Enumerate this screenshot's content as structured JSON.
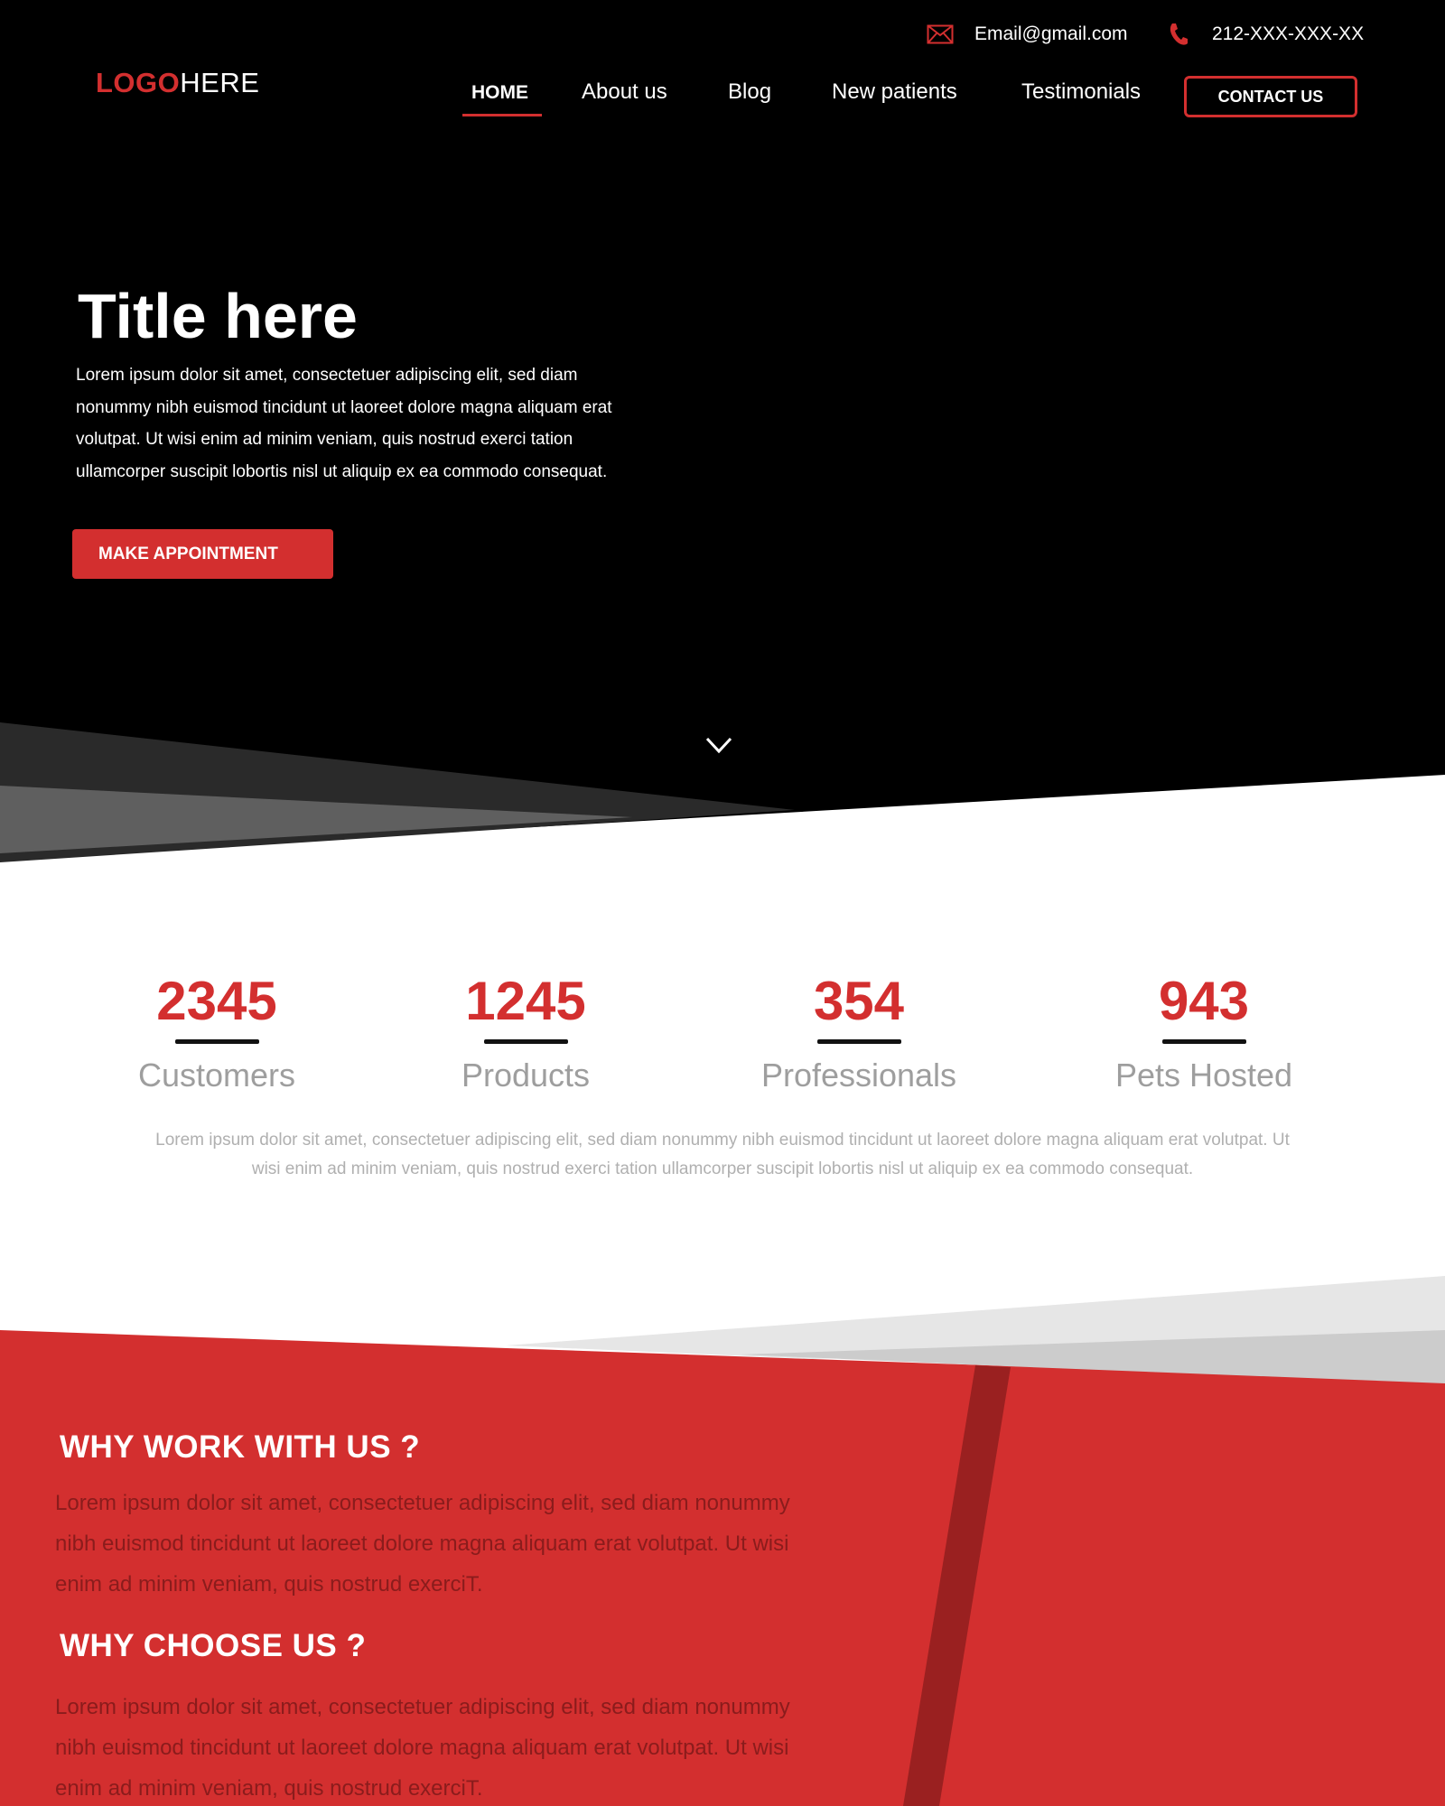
{
  "colors": {
    "accent": "#d32f2f",
    "dark_accent": "#9a2020",
    "hero_bg": "#000000",
    "muted_text": "#9e9e9e"
  },
  "contact_bar": {
    "email": "Email@gmail.com",
    "email_icon": "envelope-icon",
    "phone": "212-XXX-XXX-XX",
    "phone_icon": "phone-icon"
  },
  "logo": {
    "part1": "LOGO",
    "part2": "HERE"
  },
  "nav": {
    "items": [
      {
        "label": "HOME",
        "active": true
      },
      {
        "label": "About us"
      },
      {
        "label": "Blog"
      },
      {
        "label": "New patients"
      },
      {
        "label": "Testimonials"
      }
    ],
    "contact_button": "CONTACT US"
  },
  "hero": {
    "title": "Title here",
    "text": "Lorem ipsum dolor sit amet, consectetuer adipiscing elit, sed diam nonummy nibh euismod tincidunt ut laoreet dolore magna aliquam erat volutpat. Ut wisi enim ad minim veniam, quis nostrud exerci tation ullamcorper suscipit lobortis nisl ut aliquip ex ea commodo consequat.",
    "button": "MAKE APPOINTMENT",
    "scroll_icon": "chevron-down-icon"
  },
  "stats": {
    "items": [
      {
        "value": "2345",
        "label": "Customers"
      },
      {
        "value": "1245",
        "label": "Products"
      },
      {
        "value": "354",
        "label": "Professionals"
      },
      {
        "value": "943",
        "label": "Pets Hosted"
      }
    ],
    "text": "Lorem ipsum dolor sit amet, consectetuer adipiscing elit, sed diam nonummy nibh euismod tincidunt ut laoreet dolore magna aliquam erat volutpat. Ut wisi enim ad minim veniam, quis nostrud exerci tation ullamcorper suscipit lobortis nisl ut aliquip ex ea commodo consequat."
  },
  "red_section": {
    "heading1": "WHY WORK WITH US ?",
    "text1": "Lorem ipsum dolor sit amet, consectetuer adipiscing elit, sed diam nonummy nibh euismod tincidunt ut laoreet dolore magna aliquam erat volutpat. Ut wisi enim ad minim veniam, quis nostrud exerciT.",
    "heading2": "WHY CHOOSE US ?",
    "text2": "Lorem ipsum dolor sit amet, consectetuer adipiscing elit, sed diam nonummy nibh euismod tincidunt ut laoreet dolore magna aliquam erat volutpat. Ut wisi enim ad minim veniam, quis nostrud exerciT."
  }
}
